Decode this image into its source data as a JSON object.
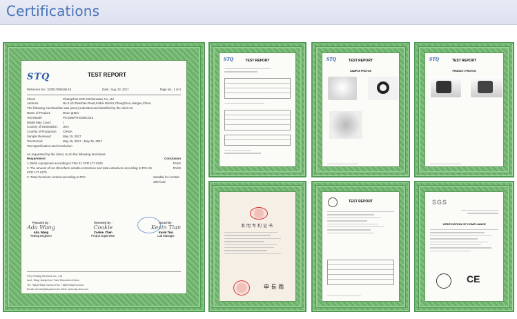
{
  "header": {
    "title": "Certifications"
  },
  "main_certificate": {
    "logo": "STQ",
    "title": "TEST REPORT",
    "reference": "Reference No.: SZ0017080436-18",
    "date": "Date : Aug. 22, 2017",
    "page": "Page No.: 1 of 4",
    "fields": [
      {
        "k": "Client:",
        "v": "Changzhou KOK Kitchenware Co.,Ltd"
      },
      {
        "k": "Address:",
        "v": "No.2-10,Tianshan Road,Xinbei District,Changzhou,Jiangsu,China"
      },
      {
        "k": "",
        "v": "The following merchandise was (were) submitted and identified by the client as:"
      },
      {
        "k": "Name of Product:",
        "v": "Drum grater"
      },
      {
        "k": "Test Model:",
        "v": "PS-D06/PS-D08/CS15"
      },
      {
        "k": "Model May Cover:",
        "v": "/"
      },
      {
        "k": "Country of Destination:",
        "v": "USA"
      },
      {
        "k": "Country of Production:",
        "v": "CHINA"
      },
      {
        "k": "Sample Received:",
        "v": "May 15, 2017"
      },
      {
        "k": "Test Period:",
        "v": "May 15, 2017 - May 25, 2017"
      },
      {
        "k": "",
        "v": "Test Specification and Conclusion"
      }
    ],
    "request_intro": "As requested by the client, to do the following test items:",
    "req_header": {
      "left": "Requirement",
      "right": "Conclusion"
    },
    "requirements": [
      {
        "left": "1.Olefin copolymers according to FDA 21 CFR 177.1520",
        "right": "PASS"
      },
      {
        "left": "2. The amount of net chloroform-soluble extractives and total extractives according to FDA 21 CFR 177.2470",
        "right": "PASS"
      },
      {
        "left": "3. Total chromium content according to FDA",
        "right": "Suitable for contact with food"
      }
    ],
    "signatures": [
      {
        "label": "Prepared By :",
        "scribble": "Ada Wang",
        "name": "Ada. Wang",
        "role": "Testing Engineer"
      },
      {
        "label": "Reviewed By :",
        "scribble": "Cookie",
        "name": "Cookie. Chen",
        "role": "Project Supervisor"
      },
      {
        "label": "Issued By :",
        "scribble": "Kevin Tian",
        "name": "Kevin Tian",
        "role": "Lab Manager"
      }
    ],
    "footer": [
      "STQ Testing Services Co., Ltd",
      "Add.: Bldg.,Sanjie Ind. Park,Shenzhen,China",
      "Tel: +86(0755)27xxxxxx   Fax: +86(0755)27xxxxxx",
      "Email: service@stq-test.com   Web: www.stq-test.com"
    ]
  },
  "thumbnails": {
    "report_title": "TEST REPORT",
    "logo": "STQ",
    "sample_photo": "SAMPLE PHOTOS",
    "product_photo": "PRODUCT PHOTOS",
    "patent_title": "发明专利证书",
    "sgs": "SGS",
    "compliance": "VERIFICATION OF COMPLIANCE",
    "ce": "CE"
  }
}
